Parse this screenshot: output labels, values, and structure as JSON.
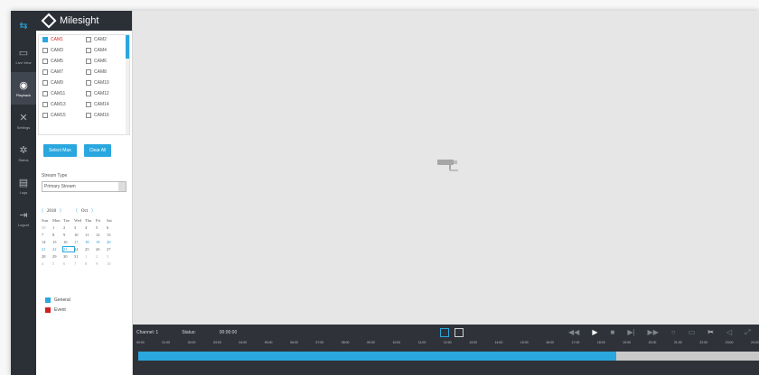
{
  "app": {
    "brand": "Milesight"
  },
  "nav": {
    "items": [
      {
        "id": "live",
        "label": "Live View",
        "icon": "camera-icon",
        "active": false
      },
      {
        "id": "playback",
        "label": "Playback",
        "icon": "playback-icon",
        "active": true
      },
      {
        "id": "settings",
        "label": "Settings",
        "icon": "tools-icon",
        "active": false
      },
      {
        "id": "status",
        "label": "Status",
        "icon": "status-icon",
        "active": false
      },
      {
        "id": "logs",
        "label": "Logs",
        "icon": "logs-icon",
        "active": false
      },
      {
        "id": "logout",
        "label": "Logout",
        "icon": "logout-icon",
        "active": false
      }
    ]
  },
  "cameras": [
    {
      "label": "CAM1",
      "checked": true
    },
    {
      "label": "CAM2",
      "checked": false
    },
    {
      "label": "CAM3",
      "checked": false
    },
    {
      "label": "CAM4",
      "checked": false
    },
    {
      "label": "CAM5",
      "checked": false
    },
    {
      "label": "CAM6",
      "checked": false
    },
    {
      "label": "CAM7",
      "checked": false
    },
    {
      "label": "CAM8",
      "checked": false
    },
    {
      "label": "CAM9",
      "checked": false
    },
    {
      "label": "CAM10",
      "checked": false
    },
    {
      "label": "CAM11",
      "checked": false
    },
    {
      "label": "CAM12",
      "checked": false
    },
    {
      "label": "CAM13",
      "checked": false
    },
    {
      "label": "CAM14",
      "checked": false
    },
    {
      "label": "CAM15",
      "checked": false
    },
    {
      "label": "CAM16",
      "checked": false
    }
  ],
  "buttons": {
    "select_max": "Select Max",
    "clear_all": "Clear All"
  },
  "stream": {
    "label": "Stream Type",
    "value": "Primary Stream"
  },
  "calendar": {
    "year": "2018",
    "month": "Oct",
    "weekdays": [
      "Sun",
      "Mon",
      "Tue",
      "Wed",
      "Thu",
      "Fri",
      "Sat"
    ],
    "weeks": [
      [
        "30",
        "1",
        "2",
        "3",
        "4",
        "5",
        "6"
      ],
      [
        "7",
        "8",
        "9",
        "10",
        "11",
        "12",
        "13"
      ],
      [
        "14",
        "15",
        "16",
        "17",
        "18",
        "19",
        "20"
      ],
      [
        "21",
        "22",
        "23",
        "24",
        "25",
        "26",
        "27"
      ],
      [
        "28",
        "29",
        "30",
        "31",
        "1",
        "2",
        "3"
      ],
      [
        "4",
        "5",
        "6",
        "7",
        "8",
        "9",
        "10"
      ]
    ],
    "selected": "23"
  },
  "legend": [
    {
      "label": "General",
      "color": "#2aa7df"
    },
    {
      "label": "Event",
      "color": "#d11f1f"
    }
  ],
  "playback": {
    "channel_label": "Channel: 1",
    "status_label": "Status:",
    "time": "00:00:00",
    "progress": 0.77
  },
  "timeline_ticks": [
    "00:00",
    "01:00",
    "02:00",
    "03:00",
    "04:00",
    "05:00",
    "06:00",
    "07:00",
    "08:00",
    "09:00",
    "10:00",
    "11:00",
    "12:00",
    "13:00",
    "14:00",
    "15:00",
    "16:00",
    "17:00",
    "18:00",
    "19:00",
    "20:00",
    "21:00",
    "22:00",
    "23:00",
    "24:00"
  ],
  "colors": {
    "accent": "#2aa7df",
    "rail": "#2b2f36",
    "event": "#d11f1f"
  }
}
